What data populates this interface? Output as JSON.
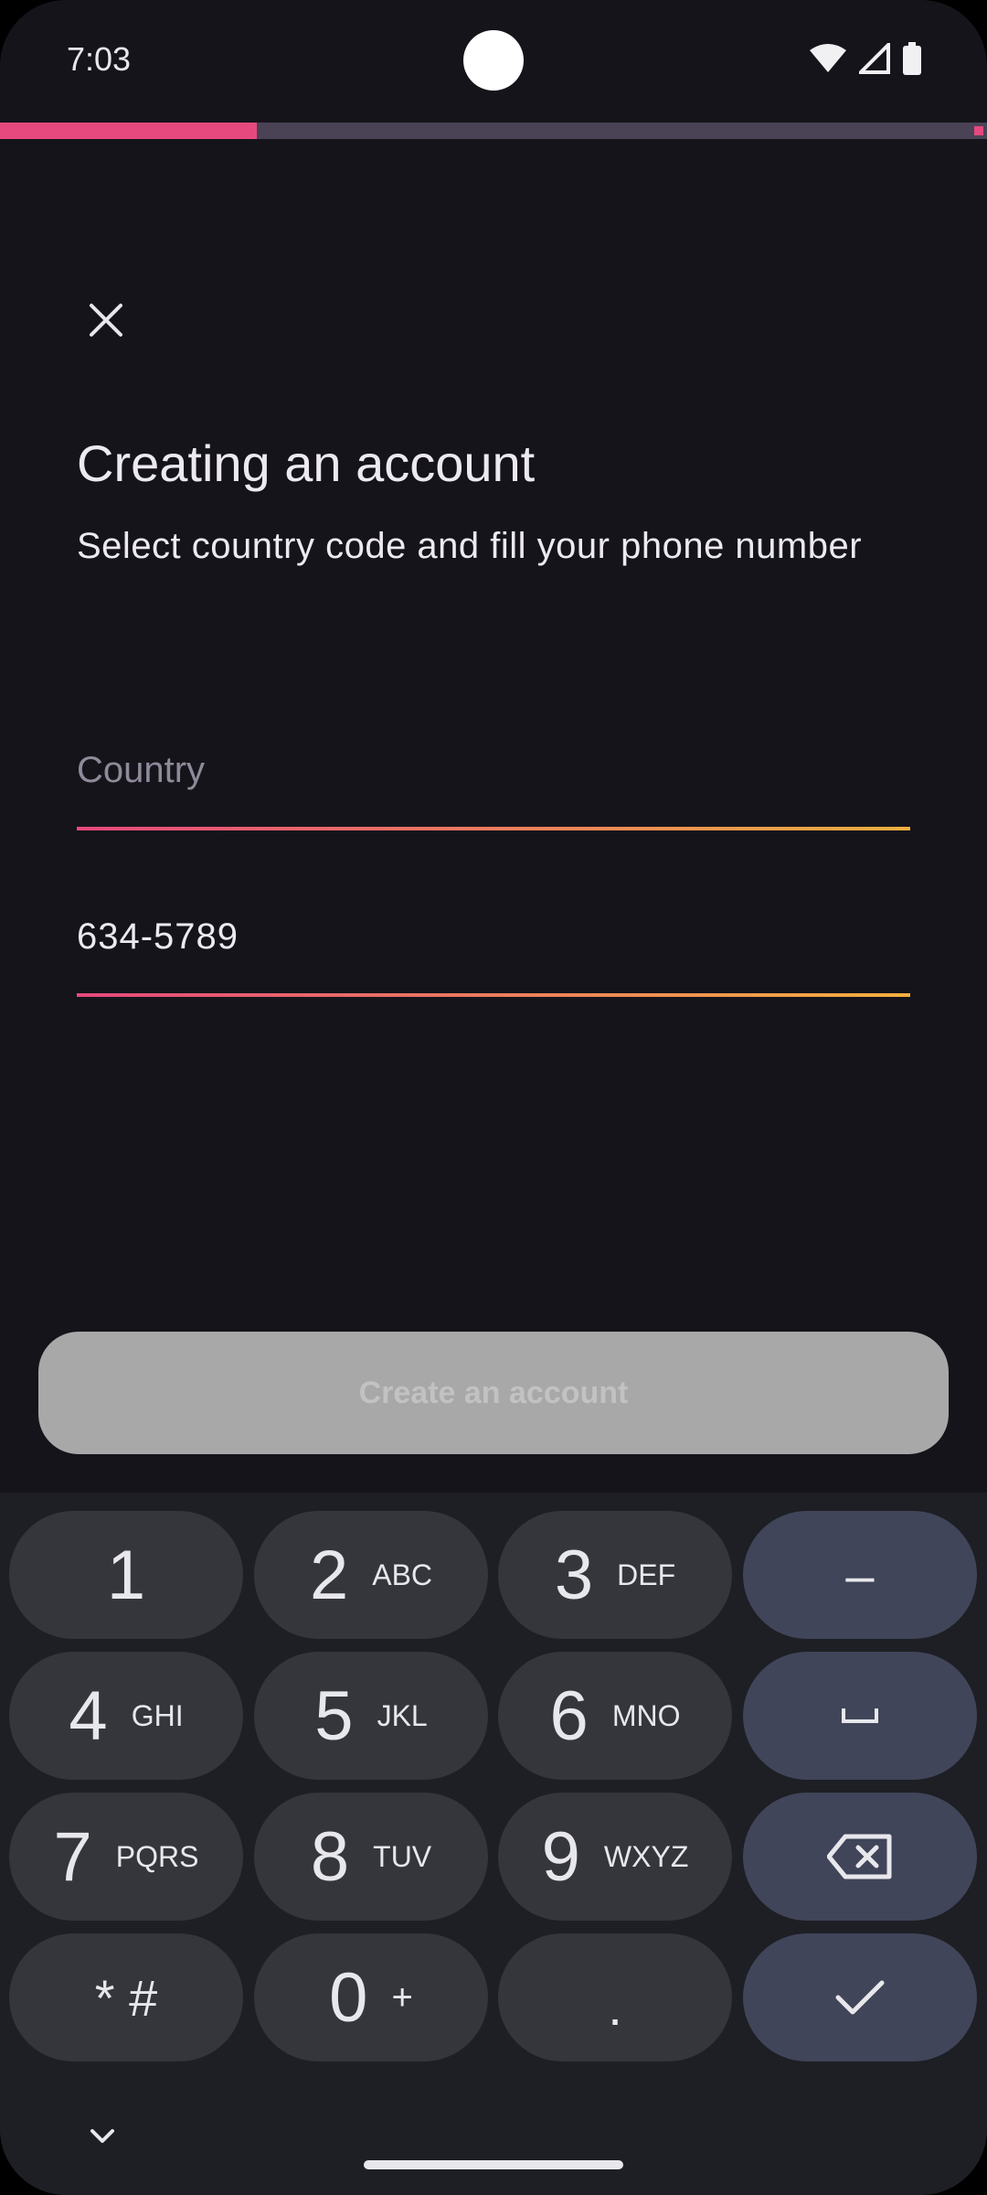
{
  "status_bar": {
    "time": "7:03",
    "icons": [
      "wifi-icon",
      "signal-icon",
      "battery-icon"
    ]
  },
  "progress": {
    "fraction": 0.26,
    "color": "#e6497d"
  },
  "header": {
    "title": "Creating an account",
    "subtitle": "Select country code and fill your phone number"
  },
  "form": {
    "country_placeholder": "Country",
    "phone_value": "634-5789"
  },
  "primary_action": {
    "label": "Create an account",
    "enabled": false
  },
  "keyboard": {
    "keys": [
      {
        "digit": "1",
        "letters": ""
      },
      {
        "digit": "2",
        "letters": "ABC"
      },
      {
        "digit": "3",
        "letters": "DEF"
      },
      {
        "digit": "4",
        "letters": "GHI"
      },
      {
        "digit": "5",
        "letters": "JKL"
      },
      {
        "digit": "6",
        "letters": "MNO"
      },
      {
        "digit": "7",
        "letters": "PQRS"
      },
      {
        "digit": "8",
        "letters": "TUV"
      },
      {
        "digit": "9",
        "letters": "WXYZ"
      },
      {
        "digit": "* #",
        "letters": ""
      },
      {
        "digit": "0",
        "letters": "+"
      },
      {
        "digit": ".",
        "letters": ""
      }
    ],
    "actions": [
      "dash-key",
      "space-key",
      "backspace-key",
      "done-key"
    ],
    "dash_label": "–"
  },
  "colors": {
    "background": "#16141b",
    "accent": "#e6497d",
    "accent_end": "#f4b03e",
    "button_disabled": "#a8a8a8"
  }
}
